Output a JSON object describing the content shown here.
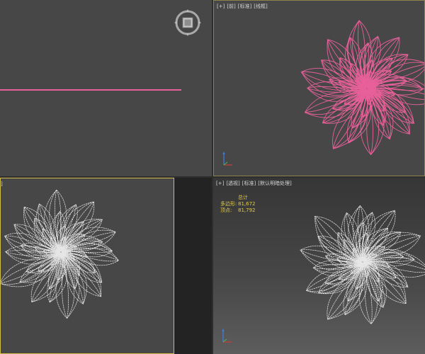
{
  "viewports": {
    "top_right": {
      "label_items": [
        "[+]",
        "[前]",
        "[标准]",
        "[线框]"
      ]
    },
    "bottom_left": {
      "label_items": [
        "]"
      ]
    },
    "bottom_right": {
      "label_items": [
        "[+]",
        "[透视]",
        "[标准]",
        "[默认明暗处理]"
      ],
      "stats": {
        "title": "总计",
        "polygons_label": "多边形:",
        "polygons_value": "81,672",
        "vertices_label": "顶点:",
        "vertices_value": "81,792"
      }
    }
  },
  "colors": {
    "selected_wire": "#e8609a",
    "wire": "#e6e6e6",
    "active_border": "#d2bd4a",
    "stats_text": "#e3cb4c",
    "axis_x": "#d03a3a",
    "axis_y": "#3fbf4f",
    "axis_z": "#3d7fe0"
  },
  "icons": {
    "viewcube": "viewcube-icon",
    "axis_tripod": "axis-tripod-icon"
  }
}
